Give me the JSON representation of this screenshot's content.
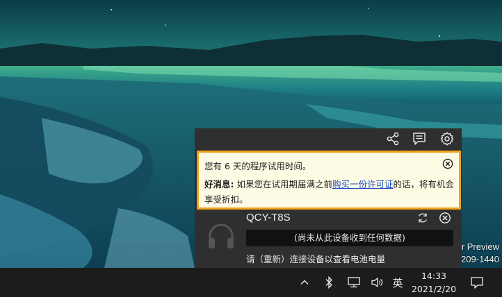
{
  "desktop": {
    "wallpaper": "night-lake-landscape",
    "watermark_line1": "r Preview",
    "watermark_line2": "209-1440"
  },
  "popup": {
    "toolbar": {
      "share_icon": "share-icon",
      "feedback_icon": "feedback-icon",
      "settings_icon": "gear-icon"
    },
    "trial": {
      "line1": "您有 6 天的程序试用时间。",
      "good_news_label": "好消息:",
      "text_before_link": "如果您在试用期届满之前",
      "link": "购买一份许可证",
      "text_after_link": "的话，将有机会享受折扣。",
      "close_icon": "close-circle-icon"
    },
    "device": {
      "icon": "headphones-icon",
      "name": "QCY-T8S",
      "status": "(尚未从此设备收到任何数据)",
      "hint": "请（重新）连接设备以查看电池电量"
    },
    "colors": {
      "accent_border": "#f0a21f",
      "link": "#1b47c9",
      "panel_bg": "#2f2f2f"
    }
  },
  "taskbar": {
    "language": "英",
    "time": "14:33",
    "date": "2021/2/20",
    "tray_icons": [
      "chevron-up-icon",
      "bluetooth-icon",
      "network-icon",
      "volume-icon",
      "notification-icon"
    ]
  }
}
